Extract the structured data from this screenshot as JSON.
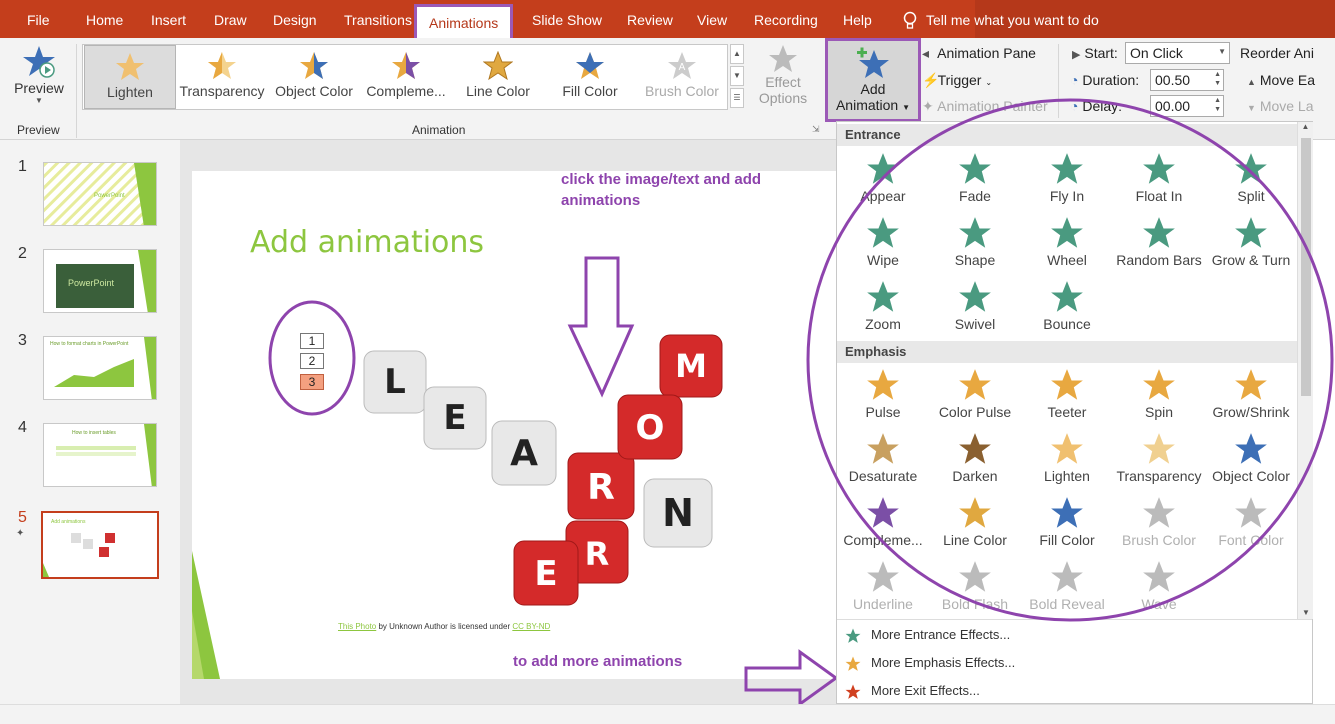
{
  "tabs": [
    "File",
    "Home",
    "Insert",
    "Draw",
    "Design",
    "Transitions",
    "Animations",
    "Slide Show",
    "Review",
    "View",
    "Recording",
    "Help"
  ],
  "tell_me": "Tell me what you want to do",
  "preview": {
    "label": "Preview",
    "group_label": "Preview"
  },
  "animation_gallery": {
    "items": [
      {
        "label": "Lighten",
        "color": "#f0c070"
      },
      {
        "label": "Transparency",
        "color": "#f0c070"
      },
      {
        "label": "Object Color",
        "color": "#3d6fb6"
      },
      {
        "label": "Compleme...",
        "color": "#7b4fa6"
      },
      {
        "label": "Line Color",
        "color": "#e0a840"
      },
      {
        "label": "Fill Color",
        "color": "#3d6fb6"
      },
      {
        "label": "Brush Color",
        "color": "#bbbbbb"
      }
    ],
    "group_label": "Animation"
  },
  "effect_options": {
    "label1": "Effect",
    "label2": "Options"
  },
  "add_animation": {
    "label1": "Add",
    "label2": "Animation"
  },
  "advanced": {
    "animation_pane": "Animation Pane",
    "trigger": "Trigger",
    "animation_painter": "Animation Painter"
  },
  "timing": {
    "start_label": "Start:",
    "start_value": "On Click",
    "duration_label": "Duration:",
    "duration_value": "00.50",
    "delay_label": "Delay:",
    "delay_value": "00.00",
    "reorder": "Reorder Ani",
    "move_earlier": "Move Ea",
    "move_later": "Move La"
  },
  "thumbnails": [
    {
      "num": "1",
      "title": "PowerPoint"
    },
    {
      "num": "2",
      "title": "PowerPoint"
    },
    {
      "num": "3",
      "title": "How to format charts in PowerPoint"
    },
    {
      "num": "4",
      "title": "How to insert tables"
    },
    {
      "num": "5",
      "title": "Add animations"
    }
  ],
  "slide": {
    "title": "Add animations",
    "order_tags": [
      "1",
      "2",
      "3"
    ],
    "dice_letters": [
      "L",
      "E",
      "A",
      "R",
      "N",
      "M",
      "O",
      "R",
      "E"
    ],
    "credit_prefix": "This Photo",
    "credit_mid": " by Unknown Author is licensed under ",
    "credit_link": "CC BY-ND"
  },
  "annotations": {
    "click_text": "click the image/text and add animations",
    "more_text": "to add more animations"
  },
  "dropdown": {
    "entrance_header": "Entrance",
    "entrance": [
      {
        "label": "Appear"
      },
      {
        "label": "Fade"
      },
      {
        "label": "Fly In"
      },
      {
        "label": "Float In"
      },
      {
        "label": "Split"
      },
      {
        "label": "Wipe"
      },
      {
        "label": "Shape"
      },
      {
        "label": "Wheel"
      },
      {
        "label": "Random Bars"
      },
      {
        "label": "Grow & Turn"
      },
      {
        "label": "Zoom"
      },
      {
        "label": "Swivel"
      },
      {
        "label": "Bounce"
      }
    ],
    "emphasis_header": "Emphasis",
    "emphasis": [
      {
        "label": "Pulse",
        "color": "#e8a840"
      },
      {
        "label": "Color Pulse",
        "color": "#e8a840"
      },
      {
        "label": "Teeter",
        "color": "#e8a840"
      },
      {
        "label": "Spin",
        "color": "#e8a840"
      },
      {
        "label": "Grow/Shrink",
        "color": "#e8a840"
      },
      {
        "label": "Desaturate",
        "color": "#c8a060"
      },
      {
        "label": "Darken",
        "color": "#8a6030"
      },
      {
        "label": "Lighten",
        "color": "#f0c070"
      },
      {
        "label": "Transparency",
        "color": "#f0d090"
      },
      {
        "label": "Object Color",
        "color": "#3d6fb6"
      },
      {
        "label": "Compleme...",
        "color": "#7b4fa6"
      },
      {
        "label": "Line Color",
        "color": "#e0a840"
      },
      {
        "label": "Fill Color",
        "color": "#3d6fb6"
      },
      {
        "label": "Brush Color",
        "color": "#bbbbbb"
      },
      {
        "label": "Font Color",
        "color": "#bbbbbb"
      },
      {
        "label": "Underline",
        "color": "#bbbbbb"
      },
      {
        "label": "Bold Flash",
        "color": "#bbbbbb"
      },
      {
        "label": "Bold Reveal",
        "color": "#bbbbbb"
      },
      {
        "label": "Wave",
        "color": "#bbbbbb"
      }
    ],
    "more_entrance": "More Entrance Effects...",
    "more_emphasis": "More Emphasis Effects...",
    "more_exit": "More Exit Effects..."
  },
  "colors": {
    "accent": "#c43e1c",
    "highlight": "#9b59b6",
    "entrance": "#4a9a80",
    "slide_green": "#8dc63f"
  }
}
